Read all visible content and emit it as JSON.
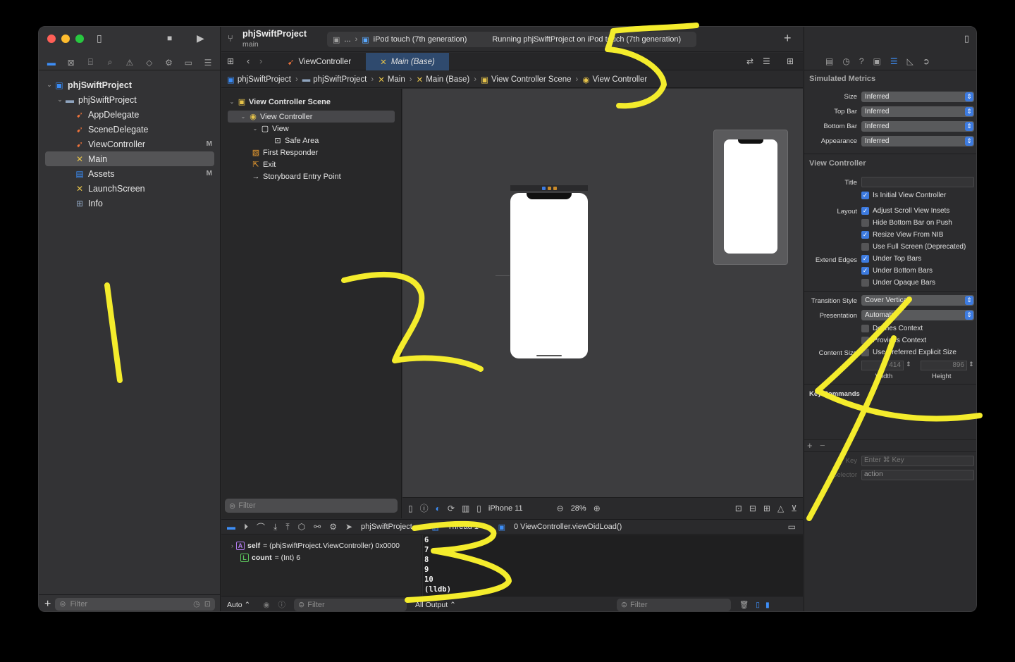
{
  "navigator": {
    "tabs": [
      "folder",
      "x-square",
      "hierarchy",
      "search",
      "warning",
      "diamond",
      "spray",
      "tag",
      "doc"
    ],
    "items": [
      {
        "label": "phjSwiftProject",
        "icon": "project-icon",
        "badge": "",
        "chev": "⌄",
        "indent": 0,
        "kind": "proj"
      },
      {
        "label": "phjSwiftProject",
        "icon": "folder-icon",
        "badge": "",
        "chev": "⌄",
        "indent": 1,
        "kind": "folder"
      },
      {
        "label": "AppDelegate",
        "icon": "swift-file-icon",
        "badge": "",
        "chev": "",
        "indent": 2,
        "kind": "swift"
      },
      {
        "label": "SceneDelegate",
        "icon": "swift-file-icon",
        "badge": "",
        "chev": "",
        "indent": 2,
        "kind": "swift"
      },
      {
        "label": "ViewController",
        "icon": "swift-file-icon",
        "badge": "M",
        "chev": "",
        "indent": 2,
        "kind": "swift"
      },
      {
        "label": "Main",
        "icon": "storyboard-icon",
        "badge": "",
        "chev": "",
        "indent": 2,
        "kind": "sb",
        "selected": true
      },
      {
        "label": "Assets",
        "icon": "assets-icon",
        "badge": "M",
        "chev": "",
        "indent": 2,
        "kind": "asset"
      },
      {
        "label": "LaunchScreen",
        "icon": "storyboard-icon",
        "badge": "",
        "chev": "",
        "indent": 2,
        "kind": "sb"
      },
      {
        "label": "Info",
        "icon": "plist-icon",
        "badge": "",
        "chev": "",
        "indent": 2,
        "kind": "folder"
      }
    ],
    "filter_placeholder": "Filter",
    "add_label": "+"
  },
  "toolbar": {
    "project_name": "phjSwiftProject",
    "branch": "main",
    "scheme_ellipsis": "...",
    "device": "iPod touch (7th generation)",
    "status": "Running phjSwiftProject on iPod touch (7th generation)",
    "add_label": "+"
  },
  "tabs": [
    {
      "label": "ViewController"
    },
    {
      "label": "Main (Base)"
    }
  ],
  "jumpbar": [
    "phjSwiftProject",
    "phjSwiftProject",
    "Main",
    "Main (Base)",
    "View Controller Scene",
    "View Controller"
  ],
  "outline": {
    "rows": [
      {
        "label": "View Controller Scene",
        "bold": true
      },
      {
        "label": "View Controller"
      },
      {
        "label": "View"
      },
      {
        "label": "Safe Area"
      },
      {
        "label": "First Responder"
      },
      {
        "label": "Exit"
      },
      {
        "label": "Storyboard Entry Point"
      }
    ],
    "filter_placeholder": "Filter"
  },
  "canvas": {
    "device": "iPhone 11",
    "zoom": "28%"
  },
  "debug": {
    "breadcrumb": [
      "phjSwiftProject",
      "Thread 1",
      "0 ViewController.viewDidLoad()"
    ],
    "vars": [
      {
        "tag": "A",
        "name": "self",
        "value": "= (phjSwiftProject.ViewController) 0x0000"
      },
      {
        "tag": "L",
        "name": "count",
        "value": "= (Int) 6"
      }
    ],
    "console_lines": [
      "6",
      "7",
      "8",
      "9",
      "10",
      "(lldb)"
    ],
    "auto_label": "Auto ⌃",
    "output_label": "All Output ⌃",
    "filter_placeholder": "Filter"
  },
  "inspector": {
    "simulated_metrics_title": "Simulated Metrics",
    "metrics": [
      {
        "label": "Size",
        "value": "Inferred"
      },
      {
        "label": "Top Bar",
        "value": "Inferred"
      },
      {
        "label": "Bottom Bar",
        "value": "Inferred"
      },
      {
        "label": "Appearance",
        "value": "Inferred"
      }
    ],
    "view_controller_title": "View Controller",
    "title_label": "Title",
    "is_initial": "Is Initial View Controller",
    "layout_label": "Layout",
    "layout_opts": [
      {
        "label": "Adjust Scroll View Insets",
        "on": true
      },
      {
        "label": "Hide Bottom Bar on Push",
        "on": false
      },
      {
        "label": "Resize View From NIB",
        "on": true
      },
      {
        "label": "Use Full Screen (Deprecated)",
        "on": false
      }
    ],
    "extend_label": "Extend Edges",
    "extend_opts": [
      {
        "label": "Under Top Bars",
        "on": true
      },
      {
        "label": "Under Bottom Bars",
        "on": true
      },
      {
        "label": "Under Opaque Bars",
        "on": false
      }
    ],
    "transition_label": "Transition Style",
    "transition_value": "Cover Vertical",
    "presentation_label": "Presentation",
    "presentation_value": "Automatic",
    "context_opts": [
      {
        "label": "Defines Context",
        "on": false
      },
      {
        "label": "Provides Context",
        "on": false
      }
    ],
    "content_size_label": "Content Size",
    "content_size_opt": "Use Preferred Explicit Size",
    "width_value": "414",
    "height_value": "896",
    "width_label": "Width",
    "height_label": "Height",
    "key_commands_title": "Key Commands",
    "key_label": "Key",
    "key_placeholder": "Enter ⌘ Key",
    "selector_label": "Selector",
    "selector_placeholder": "action"
  },
  "annotations": {
    "color": "#f4ec2c",
    "numbers": [
      "1",
      "2",
      "3",
      "4",
      "5"
    ]
  },
  "colors": {
    "accent": "#3d8ef7",
    "swift": "#f0733a",
    "storyboard": "#e6c34a"
  }
}
